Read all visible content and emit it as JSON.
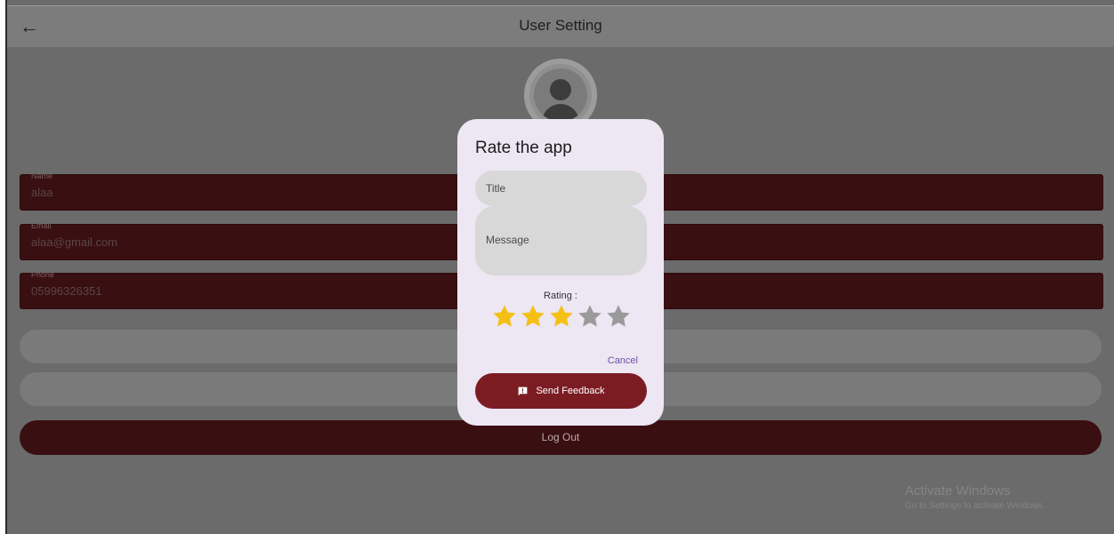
{
  "appbar": {
    "title": "User Setting",
    "back_icon": "arrow-left-icon"
  },
  "avatar": {
    "icon": "person-icon"
  },
  "fields": [
    {
      "label": "Name",
      "value": "alaa"
    },
    {
      "label": "Email",
      "value": "alaa@gmail.com"
    },
    {
      "label": "Phone",
      "value": "05996326351"
    }
  ],
  "logout_label": "Log Out",
  "watermark": {
    "line1": "Activate Windows",
    "line2": "Go to Settings to activate Windows."
  },
  "dialog": {
    "title": "Rate the app",
    "title_placeholder": "Title",
    "message_placeholder": "Message",
    "rating_label": "Rating :",
    "rating": 3,
    "rating_max": 5,
    "cancel_label": "Cancel",
    "send_label": "Send Feedback",
    "send_icon": "feedback-icon"
  },
  "colors": {
    "star_filled": "#f5c016",
    "star_empty": "#9a9a9a",
    "accent": "#7b1c22",
    "link": "#6d53a6"
  }
}
